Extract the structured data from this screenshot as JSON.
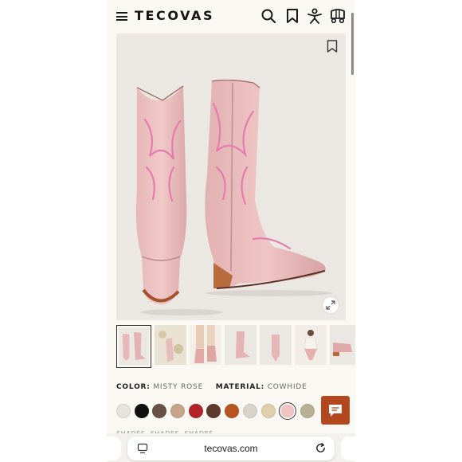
{
  "app": {
    "logo": "TECOVAS"
  },
  "header_icons": [
    "menu-icon",
    "search-icon",
    "bookmark-icon",
    "account-icon",
    "cart-wagon-icon"
  ],
  "product": {
    "color_label": "COLOR:",
    "color_value": "MISTY ROSE",
    "material_label": "MATERIAL:",
    "material_value": "COWHIDE"
  },
  "thumbnails": [
    {
      "name": "boots-pair",
      "active": true
    },
    {
      "name": "lifestyle-floral"
    },
    {
      "name": "lifestyle-legs"
    },
    {
      "name": "single-boot-side"
    },
    {
      "name": "single-boot-front"
    },
    {
      "name": "lifestyle-seated"
    },
    {
      "name": "boot-detail"
    }
  ],
  "swatches": [
    {
      "name": "white",
      "color": "#e6e3de"
    },
    {
      "name": "black",
      "color": "#111111"
    },
    {
      "name": "dark-brown",
      "color": "#6a5248"
    },
    {
      "name": "tan",
      "color": "#c6a58c"
    },
    {
      "name": "red",
      "color": "#b3232b"
    },
    {
      "name": "chocolate",
      "color": "#5e3a2c"
    },
    {
      "name": "cognac",
      "color": "#b8551e"
    },
    {
      "name": "bone",
      "color": "#d9d4cb"
    },
    {
      "name": "sand",
      "color": "#dfcfaa"
    },
    {
      "name": "misty-rose",
      "color": "#efc4c2",
      "selected": true
    },
    {
      "name": "python",
      "color": "#b8b193"
    }
  ],
  "peek_text": "SHADES, SHADES, SHADES",
  "browser": {
    "url": "tecovas.com"
  },
  "colors": {
    "accent": "#b3471e",
    "background": "#faf8f3",
    "hero_bg": "#ebe8e3"
  }
}
